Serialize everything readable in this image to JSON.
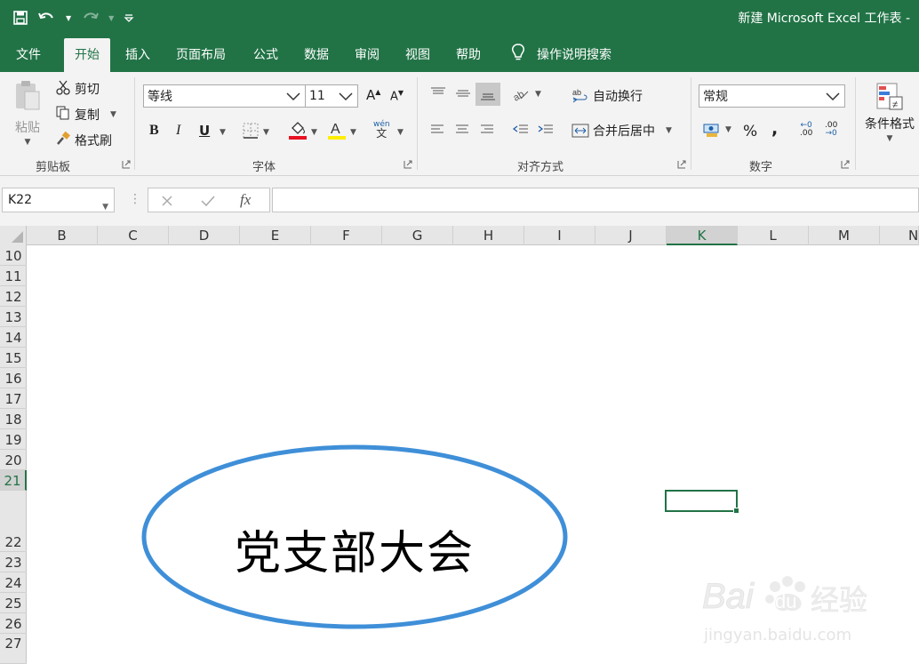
{
  "window": {
    "title": "新建 Microsoft Excel 工作表 -"
  },
  "tabs": [
    "文件",
    "开始",
    "插入",
    "页面布局",
    "公式",
    "数据",
    "审阅",
    "视图",
    "帮助"
  ],
  "tell_me": "操作说明搜索",
  "ribbon": {
    "clipboard": {
      "label": "剪贴板",
      "paste": "粘贴",
      "cut": "剪切",
      "copy": "复制",
      "format_painter": "格式刷"
    },
    "font": {
      "label": "字体",
      "font_name": "等线",
      "font_size": "11",
      "bold": "B",
      "italic": "I",
      "underline": "U",
      "phonetic_top": "wén",
      "phonetic_bottom": "文"
    },
    "alignment": {
      "label": "对齐方式",
      "wrap_text": "自动换行",
      "merge_center": "合并后居中"
    },
    "number": {
      "label": "数字",
      "format": "常规",
      "percent": "%",
      "comma": ",",
      "inc_decimal": ".00",
      "dec_decimal": ".00"
    },
    "styles": {
      "conditional_format": "条件格式"
    }
  },
  "formula_bar": {
    "name_box": "K22",
    "formula": ""
  },
  "columns": [
    "B",
    "C",
    "D",
    "E",
    "F",
    "G",
    "H",
    "I",
    "J",
    "K",
    "L",
    "M",
    "N"
  ],
  "selected_column": "K",
  "rows": [
    "10",
    "11",
    "12",
    "13",
    "14",
    "15",
    "16",
    "17",
    "18",
    "19",
    "20",
    "21",
    "22",
    "23",
    "24",
    "25",
    "26",
    "27"
  ],
  "selected_row": "22",
  "shape": {
    "text": "党支部大会",
    "stroke_color": "#3f8fd8"
  },
  "watermark": {
    "brand": "Bai",
    "brand_du": "du",
    "brand_cn": "经验",
    "url": "jingyan.baidu.com"
  },
  "colors": {
    "excel_green": "#217346",
    "ribbon_bg": "#f3f3f3",
    "header_bg": "#e6e6e6",
    "fill_red": "#e81123",
    "font_yellow": "#ffee00"
  }
}
